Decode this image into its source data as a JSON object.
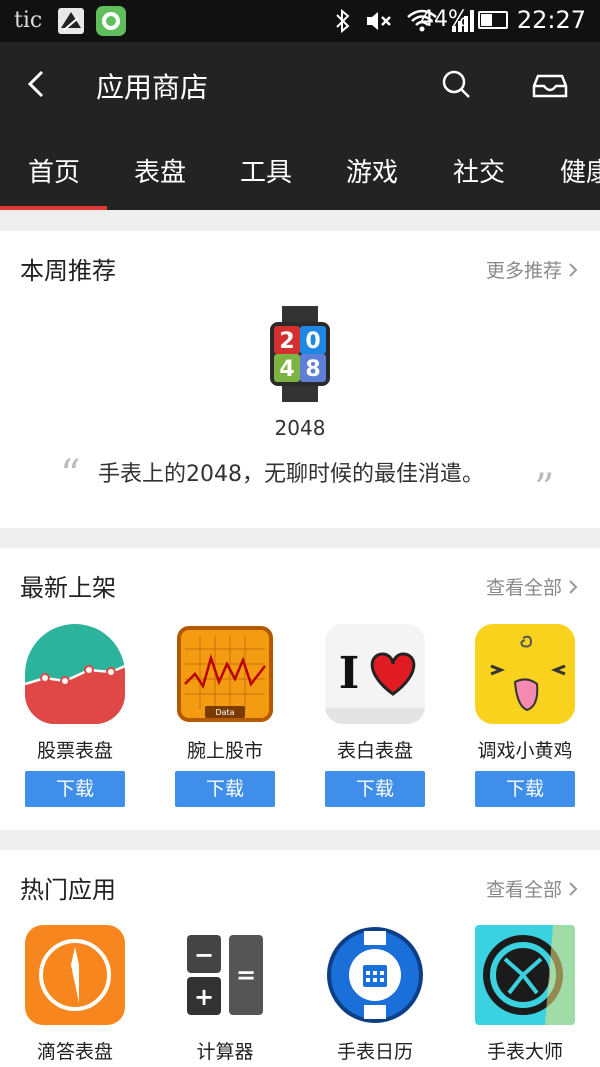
{
  "status_bar": {
    "carrier": "tic",
    "battery_text": "44%",
    "battery_level": 0.44,
    "time": "22:27",
    "icons": [
      "bluetooth-icon",
      "mute-icon",
      "wifi-icon",
      "signal-icon",
      "battery-icon"
    ]
  },
  "header": {
    "title": "应用商店",
    "icons": [
      "back-icon",
      "search-icon",
      "inbox-icon"
    ]
  },
  "tabs": [
    {
      "label": "首页",
      "active": true
    },
    {
      "label": "表盘",
      "active": false
    },
    {
      "label": "工具",
      "active": false
    },
    {
      "label": "游戏",
      "active": false
    },
    {
      "label": "社交",
      "active": false
    },
    {
      "label": "健康",
      "active": false
    }
  ],
  "weekly": {
    "title": "本周推荐",
    "more": "更多推荐",
    "app_name": "2048",
    "icon_text": [
      "2",
      "0",
      "4",
      "8"
    ],
    "description": "手表上的2048，无聊时候的最佳消遣。"
  },
  "latest": {
    "title": "最新上架",
    "more": "查看全部",
    "download_label": "下载",
    "apps": [
      {
        "name": "股票表盘",
        "icon": "stock-chart-icon"
      },
      {
        "name": "腕上股市",
        "icon": "stock-market-icon"
      },
      {
        "name": "表白表盘",
        "icon": "i-love-icon"
      },
      {
        "name": "调戏小黄鸡",
        "icon": "yellow-chick-icon"
      }
    ],
    "i_love_letter": "I",
    "stock_market_caption": "Data"
  },
  "popular": {
    "title": "热门应用",
    "more": "查看全部",
    "apps": [
      {
        "name": "滴答表盘",
        "icon": "tick-watchface-icon"
      },
      {
        "name": "计算器",
        "icon": "calculator-icon"
      },
      {
        "name": "手表日历",
        "icon": "watch-calendar-icon"
      },
      {
        "name": "手表大师",
        "icon": "watch-master-icon"
      }
    ],
    "calc_symbols": [
      "−",
      "=",
      "+"
    ]
  },
  "colors": {
    "header_bg": "#232323",
    "accent_red": "#e53935",
    "download_blue": "#3e8eea"
  }
}
